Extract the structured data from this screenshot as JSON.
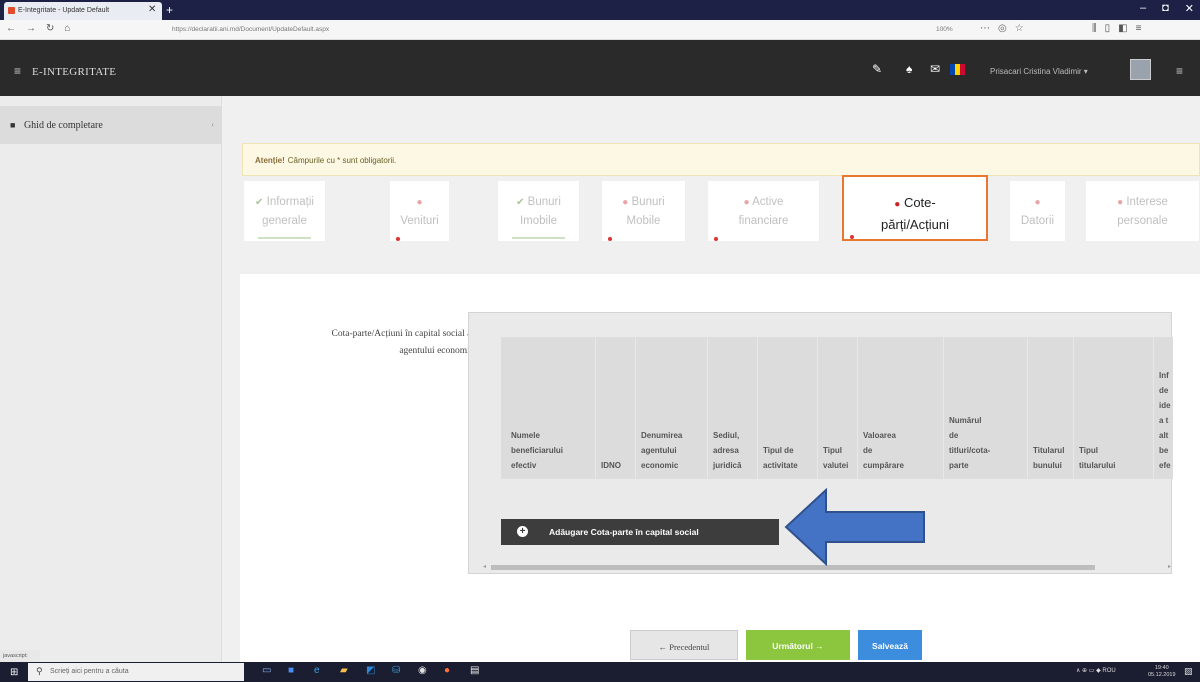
{
  "browser": {
    "tab_title": "E-Integritate - Update Default",
    "tab_close": "✕",
    "new_tab": "+",
    "url": "https://declaratii.ani.md/Document/UpdateDefault.aspx",
    "zoom": "100%",
    "window_buttons": [
      "–",
      "◘",
      "✕"
    ]
  },
  "header": {
    "brand": "E-INTEGRITATE",
    "user_name": "Prisacari Cristina Vladimir ▾",
    "flag_colors": [
      "#0046ae",
      "#ffd200",
      "#cc092f"
    ]
  },
  "sidebar": {
    "items": [
      {
        "label": "Ghid de completare"
      }
    ]
  },
  "alert": {
    "strong": "Atenție!",
    "text": "Câmpurile cu * sunt obligatorii."
  },
  "tabs": [
    {
      "line1": "Informații",
      "line2": "generale",
      "status": "ok"
    },
    {
      "line1": "",
      "line2": "Venituri",
      "status": "err"
    },
    {
      "line1": "Bunuri",
      "line2": "Imobile",
      "status": "ok"
    },
    {
      "line1": "Bunuri",
      "line2": "Mobile",
      "status": "err"
    },
    {
      "line1": "Active",
      "line2": "financiare",
      "status": "err"
    },
    {
      "line1": "Cote-",
      "line2": "părți/Acțiuni",
      "status": "active"
    },
    {
      "line1": "",
      "line2": "Datorii",
      "status": "err"
    },
    {
      "line1": "Interese",
      "line2": "personale",
      "status": "err"
    }
  ],
  "form": {
    "label_line1": "Cota-parte/Acțiuni în capital social al",
    "label_line2": "agentului economic"
  },
  "table": {
    "columns": [
      [
        "Numele",
        "beneficiarului",
        "efectiv"
      ],
      [
        "IDNO"
      ],
      [
        "Denumirea",
        "agentului",
        "economic"
      ],
      [
        "Sediul,",
        "adresa",
        "juridică"
      ],
      [
        "Tipul de",
        "activitate"
      ],
      [
        "Tipul",
        "valutei"
      ],
      [
        "Valoarea",
        "de",
        "cumpărare"
      ],
      [
        "Numărul",
        "de",
        "titluri/cota-",
        "parte"
      ],
      [
        "Titularul",
        "bunului"
      ],
      [
        "Tipul",
        "titularului"
      ],
      [
        "Inf",
        "de",
        "ide",
        "a t",
        "alt",
        "be",
        "efe"
      ]
    ],
    "add_button": "Adăugare Cota-parte în capital social"
  },
  "buttons": {
    "prev": "← Precedentul",
    "next": "Următorul →",
    "save": "Salvează"
  },
  "status_url": "javascript:",
  "taskbar": {
    "search_placeholder": "Scrieți aici pentru a căuta",
    "tray": "∧ ⊕ ▭ ◆ ROU",
    "time": "19:40",
    "date": "05.12.2019"
  }
}
